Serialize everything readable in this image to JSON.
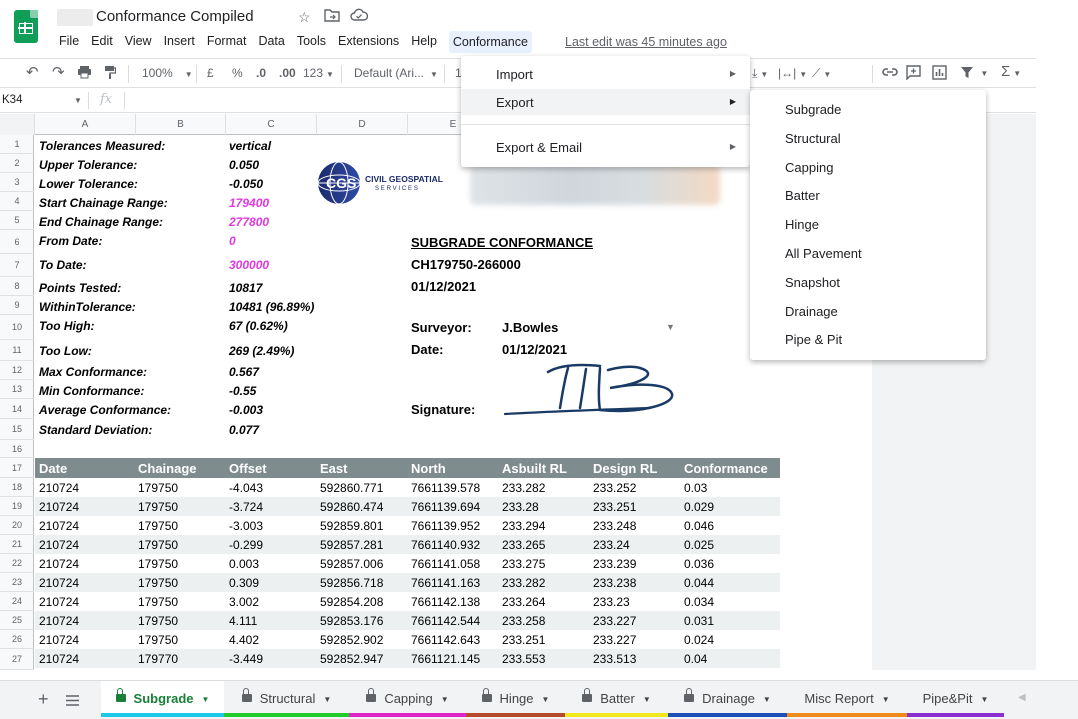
{
  "app": {
    "title": "Conformance Compiled",
    "last_edit": "Last edit was 45 minutes ago"
  },
  "menubar": [
    "File",
    "Edit",
    "View",
    "Insert",
    "Format",
    "Data",
    "Tools",
    "Extensions",
    "Help",
    "Conformance"
  ],
  "toolbar": {
    "zoom": "100%",
    "currency": "£",
    "percent": "%",
    "dec_decrease": ".0",
    "dec_increase": ".00",
    "format_more": "123",
    "font": "Default (Ari...",
    "font_size": "1"
  },
  "formula": {
    "cell_ref": "K34",
    "fx": "fx"
  },
  "columns": [
    "A",
    "B",
    "C",
    "D",
    "E"
  ],
  "rows": [
    "1",
    "2",
    "3",
    "4",
    "5",
    "6",
    "7",
    "8",
    "9",
    "10",
    "11",
    "12",
    "13",
    "14",
    "15",
    "16",
    "17",
    "18",
    "19",
    "20",
    "21",
    "22",
    "23",
    "24",
    "25",
    "26",
    "27"
  ],
  "summary": [
    {
      "label": "Tolerances Measured:",
      "value": "vertical",
      "highlight": false
    },
    {
      "label": "Upper Tolerance:",
      "value": "0.050",
      "highlight": false
    },
    {
      "label": "Lower Tolerance:",
      "value": "-0.050",
      "highlight": false
    },
    {
      "label": "Start Chainage Range:",
      "value": "179400",
      "highlight": true
    },
    {
      "label": "End Chainage Range:",
      "value": "277800",
      "highlight": true
    },
    {
      "label": "From Date:",
      "value": "0",
      "highlight": true
    },
    {
      "label": "To Date:",
      "value": "300000",
      "highlight": true
    },
    {
      "label": "Points Tested:",
      "value": "10817",
      "highlight": false
    },
    {
      "label": "WithinTolerance:",
      "value": "10481  (96.89%)",
      "highlight": false
    },
    {
      "label": "Too High:",
      "value": "67  (0.62%)",
      "highlight": false
    },
    {
      "label": "Too Low:",
      "value": "269  (2.49%)",
      "highlight": false
    },
    {
      "label": "Max Conformance:",
      "value": "0.567",
      "highlight": false
    },
    {
      "label": "Min Conformance:",
      "value": "-0.55",
      "highlight": false
    },
    {
      "label": "Average Conformance:",
      "value": "-0.003",
      "highlight": false
    },
    {
      "label": "Standard Deviation:",
      "value": "0.077",
      "highlight": false
    }
  ],
  "logo": {
    "abbr": "CGS",
    "line1": "CIVIL GEOSPATIAL",
    "line2": "SERVICES",
    "accent": "#1b2a6b"
  },
  "report": {
    "title": "SUBGRADE CONFORMANCE",
    "chainage": "CH179750-266000",
    "date": "01/12/2021",
    "surveyor_label": "Surveyor:",
    "surveyor": "J.Bowles",
    "date_label": "Date:",
    "date_value": "01/12/2021",
    "signature_label": "Signature:"
  },
  "table": {
    "headers": [
      "Date",
      "Chainage",
      "Offset",
      "East",
      "North",
      "Asbuilt RL",
      "Design RL",
      "Conformance"
    ],
    "rows": [
      [
        "210724",
        "179750",
        "-4.043",
        "592860.771",
        "7661139.578",
        "233.282",
        "233.252",
        "0.03"
      ],
      [
        "210724",
        "179750",
        "-3.724",
        "592860.474",
        "7661139.694",
        "233.28",
        "233.251",
        "0.029"
      ],
      [
        "210724",
        "179750",
        "-3.003",
        "592859.801",
        "7661139.952",
        "233.294",
        "233.248",
        "0.046"
      ],
      [
        "210724",
        "179750",
        "-0.299",
        "592857.281",
        "7661140.932",
        "233.265",
        "233.24",
        "0.025"
      ],
      [
        "210724",
        "179750",
        "0.003",
        "592857.006",
        "7661141.058",
        "233.275",
        "233.239",
        "0.036"
      ],
      [
        "210724",
        "179750",
        "0.309",
        "592856.718",
        "7661141.163",
        "233.282",
        "233.238",
        "0.044"
      ],
      [
        "210724",
        "179750",
        "3.002",
        "592854.208",
        "7661142.138",
        "233.264",
        "233.23",
        "0.034"
      ],
      [
        "210724",
        "179750",
        "4.111",
        "592853.176",
        "7661142.544",
        "233.258",
        "233.227",
        "0.031"
      ],
      [
        "210724",
        "179750",
        "4.402",
        "592852.902",
        "7661142.643",
        "233.251",
        "233.227",
        "0.024"
      ],
      [
        "210724",
        "179770",
        "-3.449",
        "592852.947",
        "7661121.145",
        "233.553",
        "233.513",
        "0.04"
      ]
    ]
  },
  "tabs": [
    {
      "label": "Subgrade",
      "locked": true,
      "active": true,
      "color": "#1ec8e8"
    },
    {
      "label": "Structural",
      "locked": true,
      "active": false,
      "color": "#1fcc2a"
    },
    {
      "label": "Capping",
      "locked": true,
      "active": false,
      "color": "#e024c7"
    },
    {
      "label": "Hinge",
      "locked": true,
      "active": false,
      "color": "#b84a2c"
    },
    {
      "label": "Batter",
      "locked": true,
      "active": false,
      "color": "#f2e81d"
    },
    {
      "label": "Drainage",
      "locked": true,
      "active": false,
      "color": "#1d4fb8"
    },
    {
      "label": "Misc Report",
      "locked": false,
      "active": false,
      "color": "#f08a1a"
    },
    {
      "label": "Pipe&Pit",
      "locked": false,
      "active": false,
      "color": "#8b2fd0"
    }
  ],
  "conformance_menu": [
    {
      "label": "Import",
      "highlight": false
    },
    {
      "label": "Export",
      "highlight": true
    },
    {
      "label": "Export & Email",
      "highlight": false
    }
  ],
  "export_menu": [
    "Subgrade",
    "Structural",
    "Capping",
    "Batter",
    "Hinge",
    "All Pavement",
    "Snapshot",
    "Drainage",
    "Pipe & Pit"
  ]
}
